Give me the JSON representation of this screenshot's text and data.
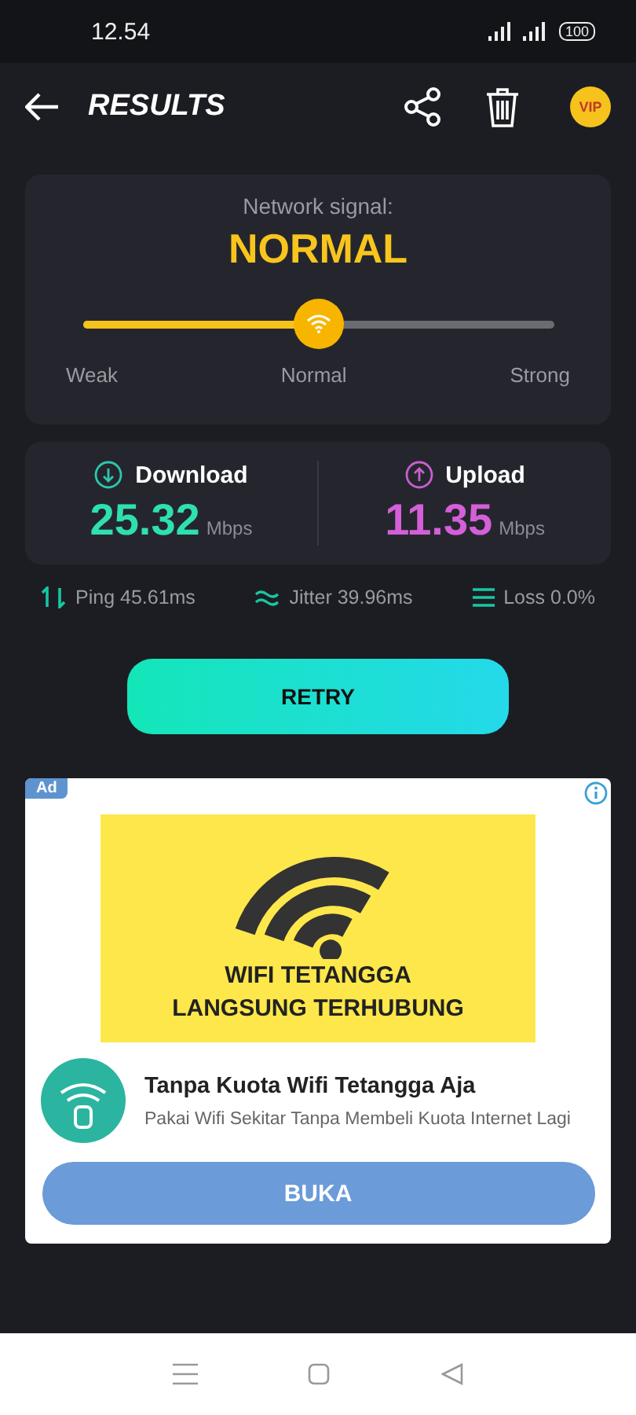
{
  "status_bar": {
    "time": "12.54",
    "battery": "100"
  },
  "header": {
    "title": "RESULTS",
    "vip": "VIP"
  },
  "signal": {
    "label": "Network signal:",
    "value": "NORMAL",
    "level": 0.5,
    "scale": [
      "Weak",
      "Normal",
      "Strong"
    ]
  },
  "speeds": [
    {
      "kind": "download",
      "label": "Download",
      "value": "25.32",
      "unit": "Mbps"
    },
    {
      "kind": "upload",
      "label": "Upload",
      "value": "11.35",
      "unit": "Mbps"
    }
  ],
  "stats": [
    {
      "kind": "ping",
      "text": "Ping 45.61ms"
    },
    {
      "kind": "jitter",
      "text": "Jitter 39.96ms"
    },
    {
      "kind": "loss",
      "text": "Loss 0.0%"
    }
  ],
  "retry_button": "RETRY",
  "ad": {
    "badge": "Ad",
    "banner_lines": [
      "WIFI TETANGGA",
      "LANGSUNG TERHUBUNG"
    ],
    "title": "Tanpa Kuota Wifi Tetangga Aja",
    "description": "Pakai Wifi Sekitar Tanpa Membeli Kuota Internet Lagi",
    "button": "BUKA"
  }
}
